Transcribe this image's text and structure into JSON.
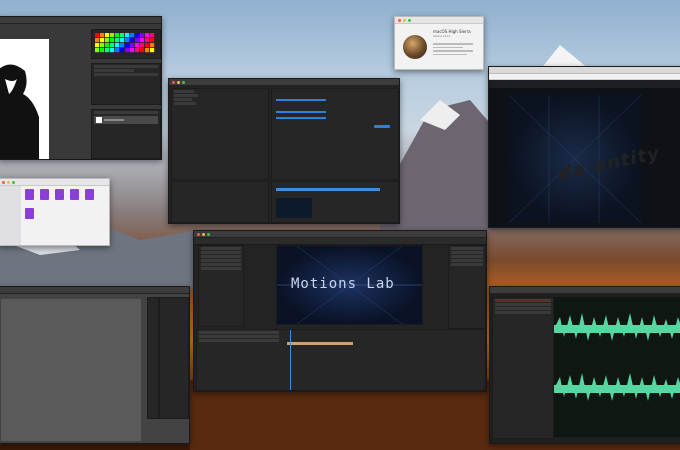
{
  "desktop": {
    "wallpaper": "High Sierra"
  },
  "about_mac": {
    "os_name": "macOS High Sierra",
    "version": "Version 10.13"
  },
  "after_effects": {
    "comp_text": "Motions Lab"
  },
  "browser": {
    "hero_text": "da·entity"
  },
  "colors": {
    "audio_wave": "#56d6a0",
    "ae_bar": "#3a8fe0",
    "accent_blue": "#2d7fe0"
  }
}
